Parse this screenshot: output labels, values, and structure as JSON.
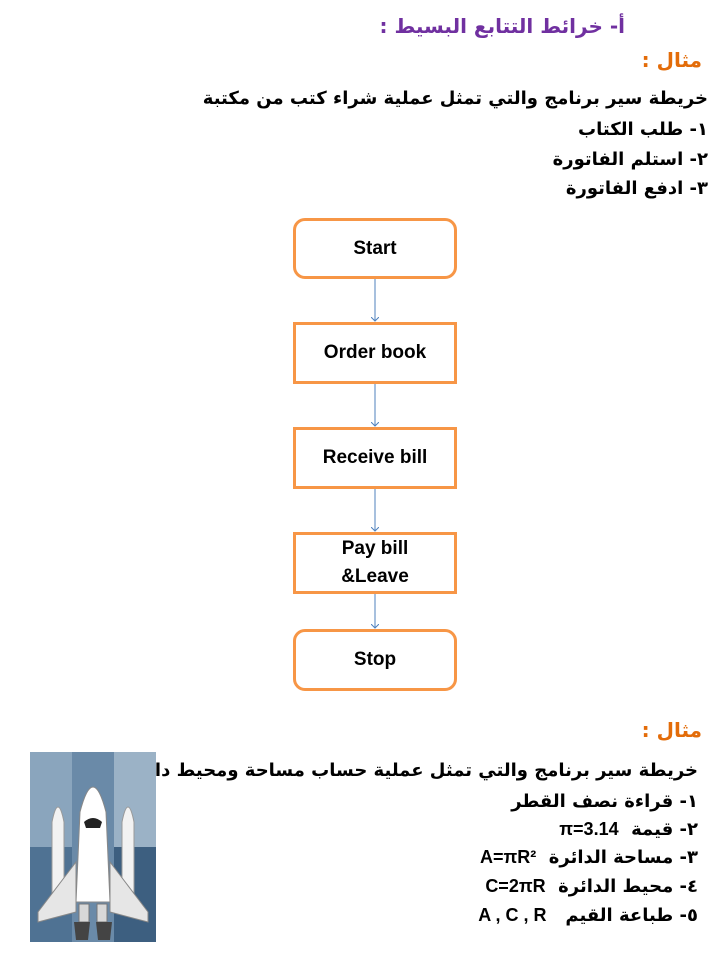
{
  "section_title": "أ- خرائط التتابع البسيط :",
  "example1": {
    "label": "مثال :",
    "description": "خريطة سير برنامج والتي تمثل عملية شراء كتب من مكتبة",
    "steps": [
      "١- طلب الكتاب",
      "٢- استلم الفاتورة",
      "٣- ادفع الفاتورة"
    ]
  },
  "flowchart": {
    "nodes": [
      "Start",
      "Order book",
      "Receive bill",
      "Pay bill\n&Leave",
      "Stop"
    ],
    "colors": {
      "box_border": "#f79646",
      "arrow": "#4f81bd"
    }
  },
  "example2": {
    "label": "مثال :",
    "description": "خريطة سير برنامج والتي تمثل عملية حساب مساحة ومحيط دائرة",
    "steps": [
      {
        "text": "١- قراءة نصف القطر",
        "formula": ""
      },
      {
        "text": "٢- قيمة",
        "formula": "π=3.14"
      },
      {
        "text": "٣- مساحة الدائرة",
        "formula": "A=πR²"
      },
      {
        "text": "٤- محيط الدائرة",
        "formula": "C=2πR"
      },
      {
        "text": "٥- طباعة القيم",
        "formula": "A , C , R"
      }
    ]
  },
  "clipart": "space-shuttle-icon",
  "colors": {
    "title": "#7030a0",
    "example_label": "#e36c09"
  }
}
